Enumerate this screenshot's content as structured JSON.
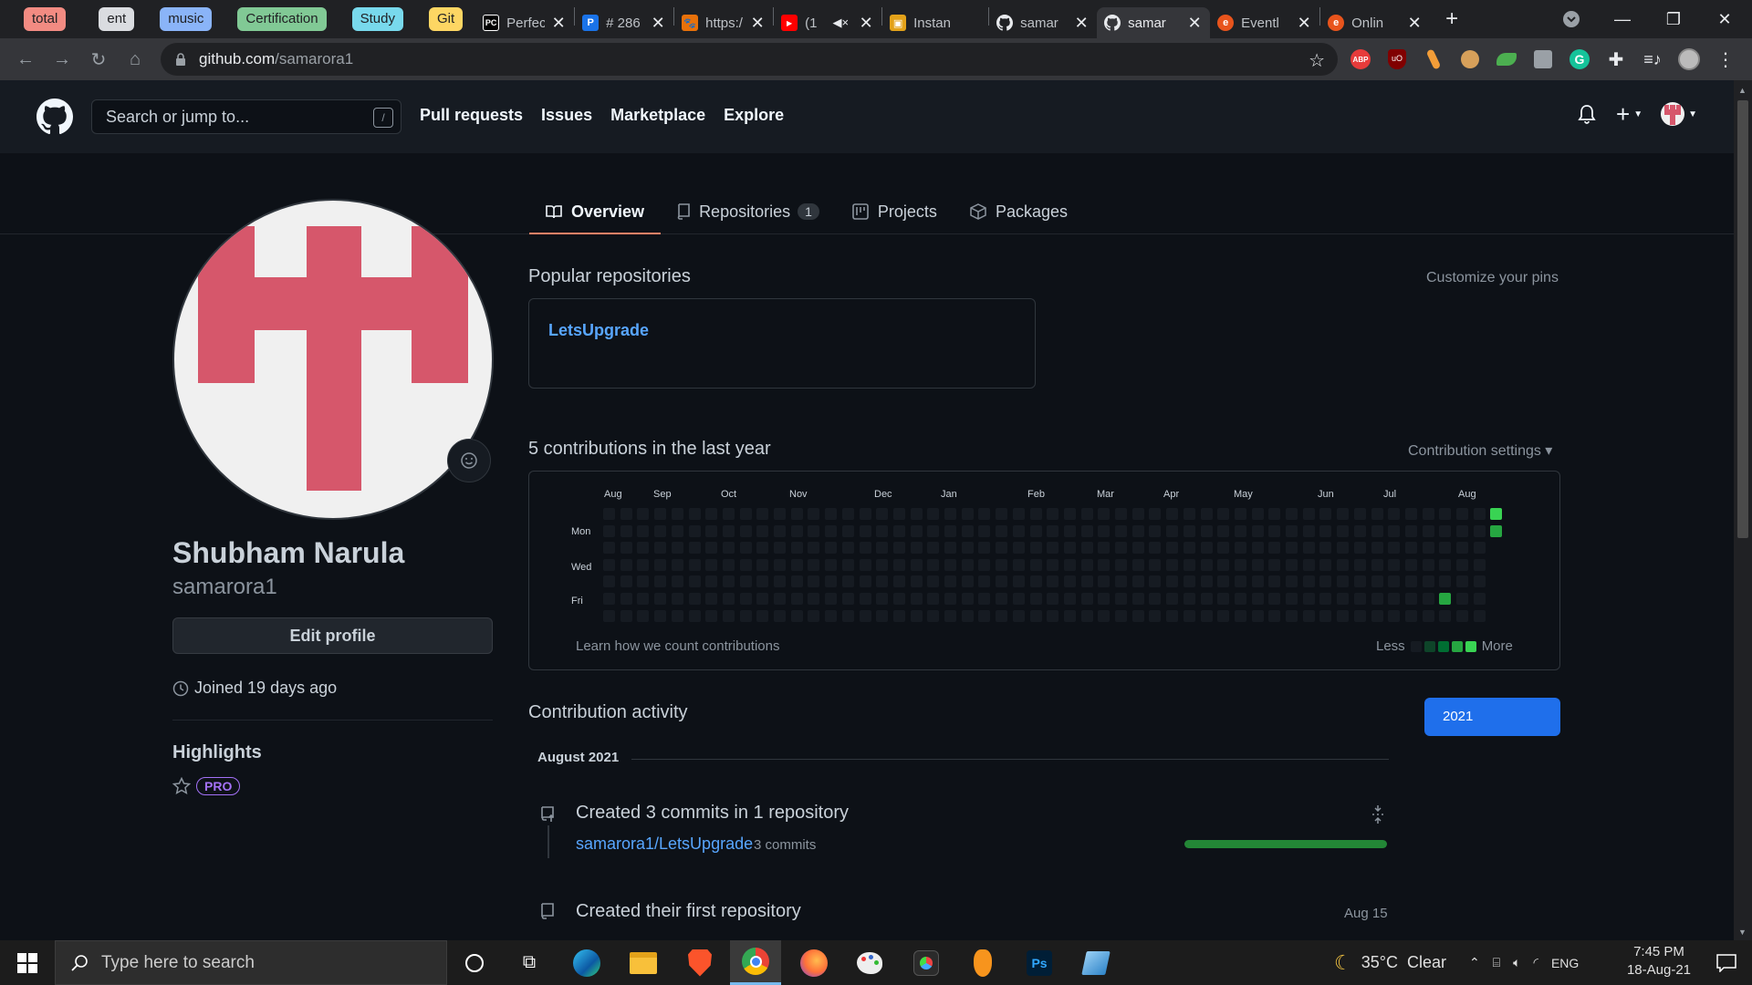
{
  "browser": {
    "tab_groups": [
      {
        "label": "total",
        "color": "#f28b82"
      },
      {
        "label": "ent",
        "color": "#dadce0"
      },
      {
        "label": "music",
        "color": "#8ab4f8"
      },
      {
        "label": "Certification",
        "color": "#81c995"
      },
      {
        "label": "Study",
        "color": "#78d9ec"
      },
      {
        "label": "Git",
        "color": "#fdd663"
      }
    ],
    "tabs": [
      {
        "title": "Perfec",
        "icon": "pycharm-icon"
      },
      {
        "title": "# 286",
        "icon": "parking-icon"
      },
      {
        "title": "https:/",
        "icon": "paw-icon"
      },
      {
        "title": "(1",
        "icon": "youtube-icon"
      },
      {
        "title": "Instan",
        "icon": "box-icon"
      },
      {
        "title": "samar",
        "icon": "github-icon"
      },
      {
        "title": "samar",
        "icon": "github-icon",
        "active": true
      },
      {
        "title": "Eventl",
        "icon": "edge-e-icon"
      },
      {
        "title": "Onlin",
        "icon": "edge-e-icon"
      }
    ],
    "url_host": "github.com",
    "url_path": "/samarora1"
  },
  "header": {
    "search_placeholder": "Search or jump to...",
    "search_shortcut": "/",
    "nav": [
      "Pull requests",
      "Issues",
      "Marketplace",
      "Explore"
    ]
  },
  "profile_tabs": [
    {
      "label": "Overview",
      "icon": "book-icon"
    },
    {
      "label": "Repositories",
      "icon": "repo-icon",
      "count": "1"
    },
    {
      "label": "Projects",
      "icon": "project-icon"
    },
    {
      "label": "Packages",
      "icon": "package-icon"
    }
  ],
  "profile": {
    "full_name": "Shubham Narula",
    "username": "samarora1",
    "edit_label": "Edit profile",
    "joined": "Joined 19 days ago",
    "highlights_heading": "Highlights",
    "pro_badge": "PRO"
  },
  "pinned": {
    "heading": "Popular repositories",
    "customize": "Customize your pins",
    "repo_name": "LetsUpgrade"
  },
  "contributions": {
    "heading": "5 contributions in the last year",
    "settings": "Contribution settings ▾",
    "months": [
      "Aug",
      "Sep",
      "Oct",
      "Nov",
      "Dec",
      "Jan",
      "Feb",
      "Mar",
      "Apr",
      "May",
      "Jun",
      "Jul",
      "Aug"
    ],
    "days": [
      "Mon",
      "Wed",
      "Fri"
    ],
    "learn_link": "Learn how we count contributions",
    "legend_less": "Less",
    "legend_more": "More",
    "colors": [
      "#161b22",
      "#0e4429",
      "#006d32",
      "#26a641",
      "#39d353"
    ]
  },
  "activity": {
    "heading": "Contribution activity",
    "year_button": "2021",
    "month_label": "August 2021",
    "commit_title": "Created 3 commits in 1 repository",
    "commit_repo": "samarora1/LetsUpgrade",
    "commit_count": "3 commits",
    "first_repo_title": "Created their first repository",
    "first_repo_date": "Aug 15"
  },
  "taskbar": {
    "search_placeholder": "Type here to search",
    "weather": "35°C  Clear",
    "lang": "ENG",
    "time": "7:45 PM",
    "date": "18-Aug-21"
  }
}
